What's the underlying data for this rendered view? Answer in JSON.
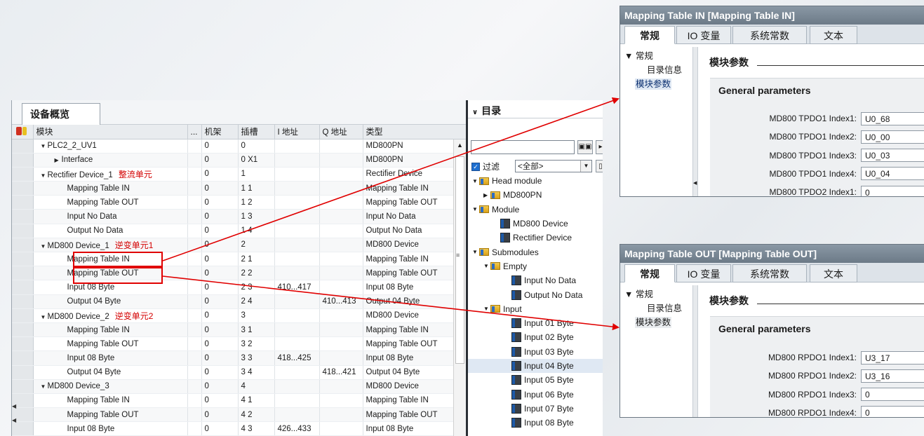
{
  "device_overview": {
    "tab": "设备概览",
    "columns": [
      "模块",
      "...",
      "机架",
      "插槽",
      "I 地址",
      "Q 地址",
      "类型"
    ],
    "rows": [
      {
        "name": "PLC2_2_UV1",
        "level": 0,
        "toggle": "▼",
        "note": "",
        "rack": "0",
        "slot": "0",
        "i_addr": "",
        "q_addr": "",
        "type": "MD800PN"
      },
      {
        "name": "Interface",
        "level": 1,
        "toggle": "▶",
        "note": "",
        "rack": "0",
        "slot": "0 X1",
        "i_addr": "",
        "q_addr": "",
        "type": "MD800PN"
      },
      {
        "name": "Rectifier Device_1",
        "level": 0,
        "toggle": "▼",
        "note": "整流单元",
        "rack": "0",
        "slot": "1",
        "i_addr": "",
        "q_addr": "",
        "type": "Rectifier Device"
      },
      {
        "name": "Mapping Table IN",
        "level": 2,
        "toggle": "",
        "note": "",
        "rack": "0",
        "slot": "1 1",
        "i_addr": "",
        "q_addr": "",
        "type": "Mapping Table IN"
      },
      {
        "name": "Mapping Table OUT",
        "level": 2,
        "toggle": "",
        "note": "",
        "rack": "0",
        "slot": "1 2",
        "i_addr": "",
        "q_addr": "",
        "type": "Mapping Table OUT"
      },
      {
        "name": "Input No Data",
        "level": 2,
        "toggle": "",
        "note": "",
        "rack": "0",
        "slot": "1 3",
        "i_addr": "",
        "q_addr": "",
        "type": "Input No Data"
      },
      {
        "name": "Output No Data",
        "level": 2,
        "toggle": "",
        "note": "",
        "rack": "0",
        "slot": "1 4",
        "i_addr": "",
        "q_addr": "",
        "type": "Output No Data"
      },
      {
        "name": "MD800 Device_1",
        "level": 0,
        "toggle": "▼",
        "note": "逆变单元1",
        "rack": "0",
        "slot": "2",
        "i_addr": "",
        "q_addr": "",
        "type": "MD800 Device"
      },
      {
        "name": "Mapping Table IN",
        "level": 2,
        "toggle": "",
        "note": "",
        "rack": "0",
        "slot": "2 1",
        "i_addr": "",
        "q_addr": "",
        "type": "Mapping Table IN"
      },
      {
        "name": "Mapping Table OUT",
        "level": 2,
        "toggle": "",
        "note": "",
        "rack": "0",
        "slot": "2 2",
        "i_addr": "",
        "q_addr": "",
        "type": "Mapping Table OUT"
      },
      {
        "name": "Input 08 Byte",
        "level": 2,
        "toggle": "",
        "note": "",
        "rack": "0",
        "slot": "2 3",
        "i_addr": "410...417",
        "q_addr": "",
        "type": "Input 08 Byte"
      },
      {
        "name": "Output 04 Byte",
        "level": 2,
        "toggle": "",
        "note": "",
        "rack": "0",
        "slot": "2 4",
        "i_addr": "",
        "q_addr": "410...413",
        "type": "Output 04 Byte"
      },
      {
        "name": "MD800 Device_2",
        "level": 0,
        "toggle": "▼",
        "note": "逆变单元2",
        "rack": "0",
        "slot": "3",
        "i_addr": "",
        "q_addr": "",
        "type": "MD800 Device"
      },
      {
        "name": "Mapping Table IN",
        "level": 2,
        "toggle": "",
        "note": "",
        "rack": "0",
        "slot": "3 1",
        "i_addr": "",
        "q_addr": "",
        "type": "Mapping Table IN"
      },
      {
        "name": "Mapping Table OUT",
        "level": 2,
        "toggle": "",
        "note": "",
        "rack": "0",
        "slot": "3 2",
        "i_addr": "",
        "q_addr": "",
        "type": "Mapping Table OUT"
      },
      {
        "name": "Input 08 Byte",
        "level": 2,
        "toggle": "",
        "note": "",
        "rack": "0",
        "slot": "3 3",
        "i_addr": "418...425",
        "q_addr": "",
        "type": "Input 08 Byte"
      },
      {
        "name": "Output 04 Byte",
        "level": 2,
        "toggle": "",
        "note": "",
        "rack": "0",
        "slot": "3 4",
        "i_addr": "",
        "q_addr": "418...421",
        "type": "Output 04 Byte"
      },
      {
        "name": "MD800 Device_3",
        "level": 0,
        "toggle": "▼",
        "note": "",
        "rack": "0",
        "slot": "4",
        "i_addr": "",
        "q_addr": "",
        "type": "MD800 Device"
      },
      {
        "name": "Mapping Table IN",
        "level": 2,
        "toggle": "",
        "note": "",
        "rack": "0",
        "slot": "4 1",
        "i_addr": "",
        "q_addr": "",
        "type": "Mapping Table IN"
      },
      {
        "name": "Mapping Table OUT",
        "level": 2,
        "toggle": "",
        "note": "",
        "rack": "0",
        "slot": "4 2",
        "i_addr": "",
        "q_addr": "",
        "type": "Mapping Table OUT"
      },
      {
        "name": "Input 08 Byte",
        "level": 2,
        "toggle": "",
        "note": "",
        "rack": "0",
        "slot": "4 3",
        "i_addr": "426...433",
        "q_addr": "",
        "type": "Input 08 Byte"
      }
    ]
  },
  "catalog": {
    "title": "目录",
    "search_value": "",
    "filter_label": "过滤",
    "filter_checked": true,
    "filter_value": "<全部>",
    "tree": [
      {
        "label": "Head module",
        "toggle": "▼",
        "icon": "folder",
        "indent": 0
      },
      {
        "label": "MD800PN",
        "toggle": "▶",
        "icon": "folder",
        "indent": 1
      },
      {
        "label": "Module",
        "toggle": "▼",
        "icon": "folder",
        "indent": 0
      },
      {
        "label": "MD800 Device",
        "toggle": "",
        "icon": "module",
        "indent": 2
      },
      {
        "label": "Rectifier Device",
        "toggle": "",
        "icon": "module",
        "indent": 2
      },
      {
        "label": "Submodules",
        "toggle": "▼",
        "icon": "folder",
        "indent": 0
      },
      {
        "label": "Empty",
        "toggle": "▼",
        "icon": "folder",
        "indent": 1
      },
      {
        "label": "Input No Data",
        "toggle": "",
        "icon": "module",
        "indent": 3
      },
      {
        "label": "Output No Data",
        "toggle": "",
        "icon": "module",
        "indent": 3
      },
      {
        "label": "Input",
        "toggle": "▼",
        "icon": "folder",
        "indent": 1
      },
      {
        "label": "Input 01 Byte",
        "toggle": "",
        "icon": "module",
        "indent": 3
      },
      {
        "label": "Input 02 Byte",
        "toggle": "",
        "icon": "module",
        "indent": 3
      },
      {
        "label": "Input 03 Byte",
        "toggle": "",
        "icon": "module",
        "indent": 3
      },
      {
        "label": "Input 04 Byte",
        "toggle": "",
        "icon": "module",
        "indent": 3,
        "selected": true
      },
      {
        "label": "Input 05 Byte",
        "toggle": "",
        "icon": "module",
        "indent": 3
      },
      {
        "label": "Input 06 Byte",
        "toggle": "",
        "icon": "module",
        "indent": 3
      },
      {
        "label": "Input 07 Byte",
        "toggle": "",
        "icon": "module",
        "indent": 3
      },
      {
        "label": "Input 08 Byte",
        "toggle": "",
        "icon": "module",
        "indent": 3
      }
    ]
  },
  "win_in": {
    "title": "Mapping Table IN [Mapping Table IN]",
    "tabs": [
      "常规",
      "IO 变量",
      "系统常数",
      "文本"
    ],
    "nav": [
      "▼ 常规",
      "目录信息",
      "模块参数"
    ],
    "section": "模块参数",
    "group": "General parameters",
    "params": [
      {
        "label": "MD800 TPDO1 Index1:",
        "value": "U0_68"
      },
      {
        "label": "MD800 TPDO1 Index2:",
        "value": "U0_00"
      },
      {
        "label": "MD800 TPDO1 Index3:",
        "value": "U0_03"
      },
      {
        "label": "MD800 TPDO1 Index4:",
        "value": "U0_04"
      },
      {
        "label": "MD800 TPDO2 Index1:",
        "value": "0"
      }
    ]
  },
  "win_out": {
    "title": "Mapping Table OUT [Mapping Table OUT]",
    "tabs": [
      "常规",
      "IO 变量",
      "系统常数",
      "文本"
    ],
    "nav": [
      "▼ 常规",
      "目录信息",
      "模块参数"
    ],
    "section": "模块参数",
    "group": "General parameters",
    "params": [
      {
        "label": "MD800 RPDO1 Index1:",
        "value": "U3_17"
      },
      {
        "label": "MD800 RPDO1 Index2:",
        "value": "U3_16"
      },
      {
        "label": "MD800 RPDO1 Index3:",
        "value": "0"
      },
      {
        "label": "MD800 RPDO1 Index4:",
        "value": "0"
      }
    ]
  },
  "colors": {
    "annotation": "#e00000",
    "selection": "#dfe8f3",
    "title_bar": "#7b8996"
  }
}
